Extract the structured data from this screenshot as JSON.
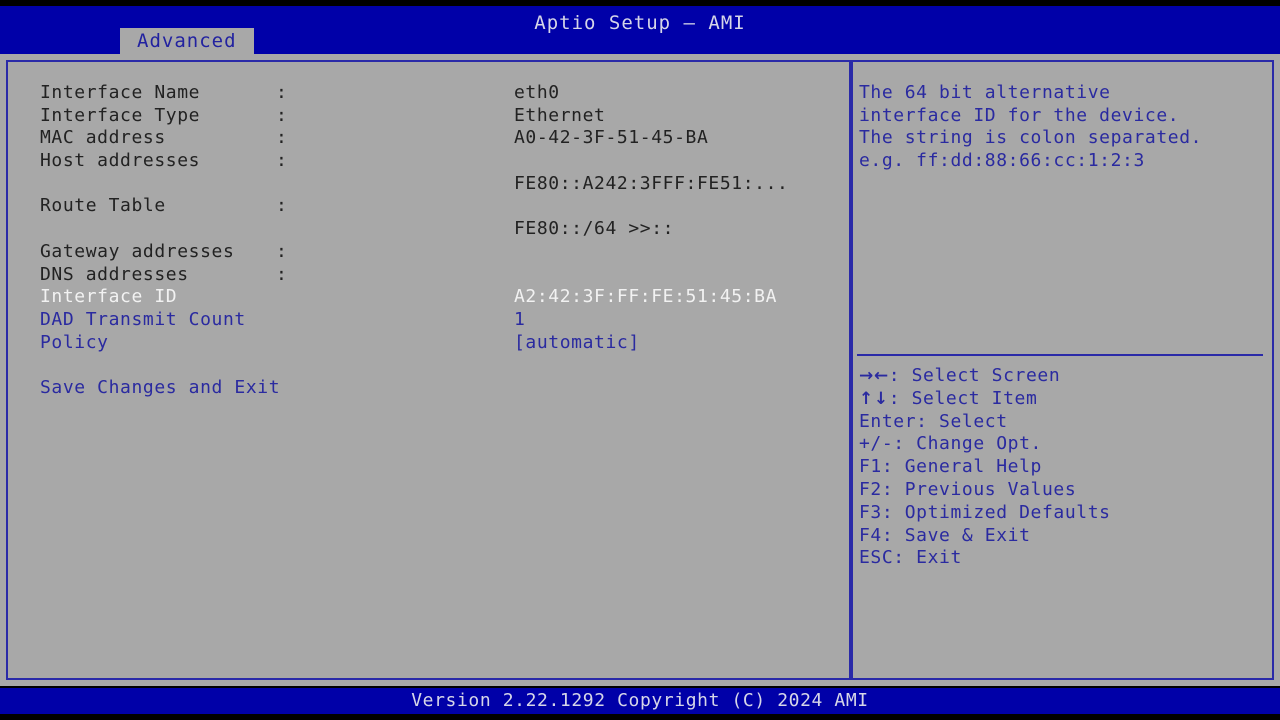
{
  "app": {
    "title": "Aptio Setup – AMI",
    "footer": "Version 2.22.1292 Copyright (C) 2024 AMI"
  },
  "colors": {
    "title_bar_bg": "#0000a8",
    "panel_bg": "#a8a8a8",
    "border": "#2a2aa8",
    "text_blue": "#2a2aa0",
    "text_dark": "#222222",
    "text_selected": "#f2f2f2",
    "screen_bg": "#000000"
  },
  "tabs": [
    {
      "label": "Advanced",
      "active": true
    }
  ],
  "settings": [
    {
      "label": "Interface Name",
      "colon": ":",
      "value": "eth0",
      "label_color": "dark",
      "value_color": "dark",
      "selected": false,
      "interactable": false
    },
    {
      "label": "Interface Type",
      "colon": ":",
      "value": "Ethernet",
      "label_color": "dark",
      "value_color": "dark",
      "selected": false,
      "interactable": false
    },
    {
      "label": "MAC address",
      "colon": ":",
      "value": "A0-42-3F-51-45-BA",
      "label_color": "dark",
      "value_color": "dark",
      "selected": false,
      "interactable": false
    },
    {
      "label": "Host addresses",
      "colon": ":",
      "value": "",
      "label_color": "dark",
      "value_color": "dark",
      "selected": false,
      "interactable": false
    },
    {
      "label": "",
      "colon": "",
      "value": "FE80::A242:3FFF:FE51:...",
      "label_color": "dark",
      "value_color": "dark",
      "selected": false,
      "interactable": false
    },
    {
      "label": "Route Table",
      "colon": ":",
      "value": "",
      "label_color": "dark",
      "value_color": "dark",
      "selected": false,
      "interactable": false
    },
    {
      "label": "",
      "colon": "",
      "value": "FE80::/64 >>::",
      "label_color": "dark",
      "value_color": "dark",
      "selected": false,
      "interactable": false
    },
    {
      "label": "Gateway addresses",
      "colon": ":",
      "value": "",
      "label_color": "dark",
      "value_color": "dark",
      "selected": false,
      "interactable": false
    },
    {
      "label": "DNS addresses",
      "colon": ":",
      "value": "",
      "label_color": "dark",
      "value_color": "dark",
      "selected": false,
      "interactable": false
    },
    {
      "label": "Interface ID",
      "colon": "",
      "value": "A2:42:3F:FF:FE:51:45:BA",
      "label_color": "white",
      "value_color": "white",
      "selected": true,
      "interactable": true
    },
    {
      "label": "DAD Transmit Count",
      "colon": "",
      "value": "1",
      "label_color": "blue",
      "value_color": "blue",
      "selected": false,
      "interactable": true
    },
    {
      "label": "Policy",
      "colon": "",
      "value": "[automatic]",
      "label_color": "blue",
      "value_color": "blue",
      "selected": false,
      "interactable": true
    }
  ],
  "actions": [
    {
      "label": "Save Changes and Exit",
      "color": "blue",
      "interactable": true
    }
  ],
  "help": {
    "lines": [
      "The 64 bit alternative",
      "interface ID for the device.",
      "The string is colon separated.",
      "e.g. ff:dd:88:66:cc:1:2:3"
    ]
  },
  "legend": [
    {
      "glyph": "→←",
      "text": ": Select Screen"
    },
    {
      "glyph": "↑↓",
      "text": ": Select Item"
    },
    {
      "glyph": "",
      "text": "Enter: Select"
    },
    {
      "glyph": "",
      "text": "+/-: Change Opt."
    },
    {
      "glyph": "",
      "text": "F1: General Help"
    },
    {
      "glyph": "",
      "text": "F2: Previous Values"
    },
    {
      "glyph": "",
      "text": "F3: Optimized Defaults"
    },
    {
      "glyph": "",
      "text": "F4: Save & Exit"
    },
    {
      "glyph": "",
      "text": "ESC: Exit"
    }
  ]
}
